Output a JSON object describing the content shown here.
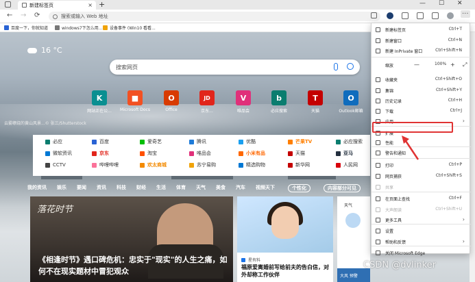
{
  "browser": {
    "tab_title": "新建标签页",
    "new_tab_symbol": "+",
    "tab_close": "×",
    "win_min": "—",
    "win_max": "☐",
    "win_close": "✕",
    "address_placeholder": "搜索或输入 Web 地址",
    "nav": {
      "back": "←",
      "forward": "→",
      "refresh": "⟳"
    },
    "more_button": "···"
  },
  "favorites": [
    {
      "label": "百度一下，你就知道",
      "color": "#2a63d4"
    },
    {
      "label": "windows7下怎么用...",
      "color": "#777777"
    },
    {
      "label": "设备事件 (Win10 看看...",
      "color": "#f0a30a"
    }
  ],
  "weather": {
    "temp": "16 °C"
  },
  "search": {
    "placeholder": "搜索网页"
  },
  "tiles": [
    {
      "label": "网站正在公...",
      "glyph": "K",
      "color": "#0a8f91"
    },
    {
      "label": "Microsoft Docs",
      "glyph": "■",
      "color": "#f25022"
    },
    {
      "label": "Office",
      "glyph": "O",
      "color": "#d83b01"
    },
    {
      "label": "京东...",
      "glyph": "JD",
      "color": "#e1251b"
    },
    {
      "label": "唯品会",
      "glyph": "V",
      "color": "#e0307a"
    },
    {
      "label": "必应搜索",
      "glyph": "b",
      "color": "#0b7d6f"
    },
    {
      "label": "天猫",
      "glyph": "T",
      "color": "#c40000"
    },
    {
      "label": "Outlook邮箱",
      "glyph": "O",
      "color": "#0f6cbd"
    }
  ],
  "caption": "云雾缭绕的黄山风景...© 张三/Shutterstock",
  "links": [
    [
      "必应",
      "百度",
      "爱奇艺",
      "腾讯",
      "优酷",
      "芒果TV",
      "必应搜索"
    ],
    [
      "微软资讯",
      "京东",
      "淘宝",
      "唯品会",
      "小米有品",
      "天猫",
      "亚马"
    ],
    [
      "CCTV",
      "哔哩哔哩",
      "欢太商城",
      "苏宁易购",
      "精选购物",
      "新华网",
      "人民网"
    ]
  ],
  "link_colors": [
    [
      "#0b7d6f",
      "#2a63d4",
      "#00be06",
      "#1e7bd8",
      "#1aa0f0",
      "#ff7f00",
      "#0b7d6f"
    ],
    [
      "#0078d4",
      "#e1251b",
      "#ff5000",
      "#e0307a",
      "#ff6700",
      "#c40000",
      "#232f3e"
    ],
    [
      "#444444",
      "#fb7299",
      "#f38a00",
      "#f0a30a",
      "#0078d4",
      "#c40000",
      "#d8000b"
    ]
  ],
  "link_bold": [
    [
      false,
      false,
      false,
      false,
      false,
      true,
      false
    ],
    [
      false,
      true,
      false,
      false,
      true,
      false,
      true
    ],
    [
      false,
      false,
      true,
      false,
      false,
      false,
      false
    ]
  ],
  "news_nav": [
    "我的资讯",
    "娱乐",
    "要闻",
    "资讯",
    "科技",
    "财经",
    "生活",
    "体育",
    "天气",
    "美食",
    "汽车",
    "视频天下"
  ],
  "news_nav_pills": [
    "个性化",
    "内容部分可见"
  ],
  "card_main": {
    "calligraphy": "落花时节",
    "headline": "《相逢时节》遇口碑危机：忠实于\"现实\"的人生之痛，如何不在现实题材中冒犯观众"
  },
  "card_second": {
    "source": "星有料",
    "title": "福原爱离婚前写给前夫的告白信，对外却称工作伙伴"
  },
  "card_weather": {
    "title": "天气",
    "bottom": "大风 预警"
  },
  "watermark": "CSDN @dvlinker",
  "menu": {
    "items": [
      {
        "label": "新建标签页",
        "shortcut": "Ctrl+T"
      },
      {
        "label": "新建窗口",
        "shortcut": "Ctrl+N"
      },
      {
        "label": "新建 InPrivate 窗口",
        "shortcut": "Ctrl+Shift+N"
      },
      {
        "label": "收藏夹",
        "shortcut": "Ctrl+Shift+O"
      },
      {
        "label": "集锦",
        "shortcut": "Ctrl+Shift+Y"
      },
      {
        "label": "历史记录",
        "shortcut": "Ctrl+H"
      },
      {
        "label": "下载",
        "shortcut": "Ctrl+J"
      },
      {
        "label": "应用",
        "shortcut": ""
      },
      {
        "label": "扩展",
        "shortcut": ""
      },
      {
        "label": "性能",
        "shortcut": ""
      },
      {
        "label": "警告和通知",
        "shortcut": ""
      },
      {
        "label": "打印",
        "shortcut": "Ctrl+P"
      },
      {
        "label": "网页捕获",
        "shortcut": "Ctrl+Shift+S"
      },
      {
        "label": "共享",
        "shortcut": ""
      },
      {
        "label": "在页面上查找",
        "shortcut": "Ctrl+F"
      },
      {
        "label": "大声朗读",
        "shortcut": "Ctrl+Shift+U"
      },
      {
        "label": "更多工具",
        "shortcut": ""
      },
      {
        "label": "设置",
        "shortcut": ""
      },
      {
        "label": "帮助和反馈",
        "shortcut": ""
      },
      {
        "label": "关闭 Microsoft Edge",
        "shortcut": ""
      }
    ],
    "zoom": {
      "label": "缩放",
      "minus": "—",
      "value": "100%",
      "plus": "+",
      "full": "⤢"
    },
    "chevron": "›"
  }
}
